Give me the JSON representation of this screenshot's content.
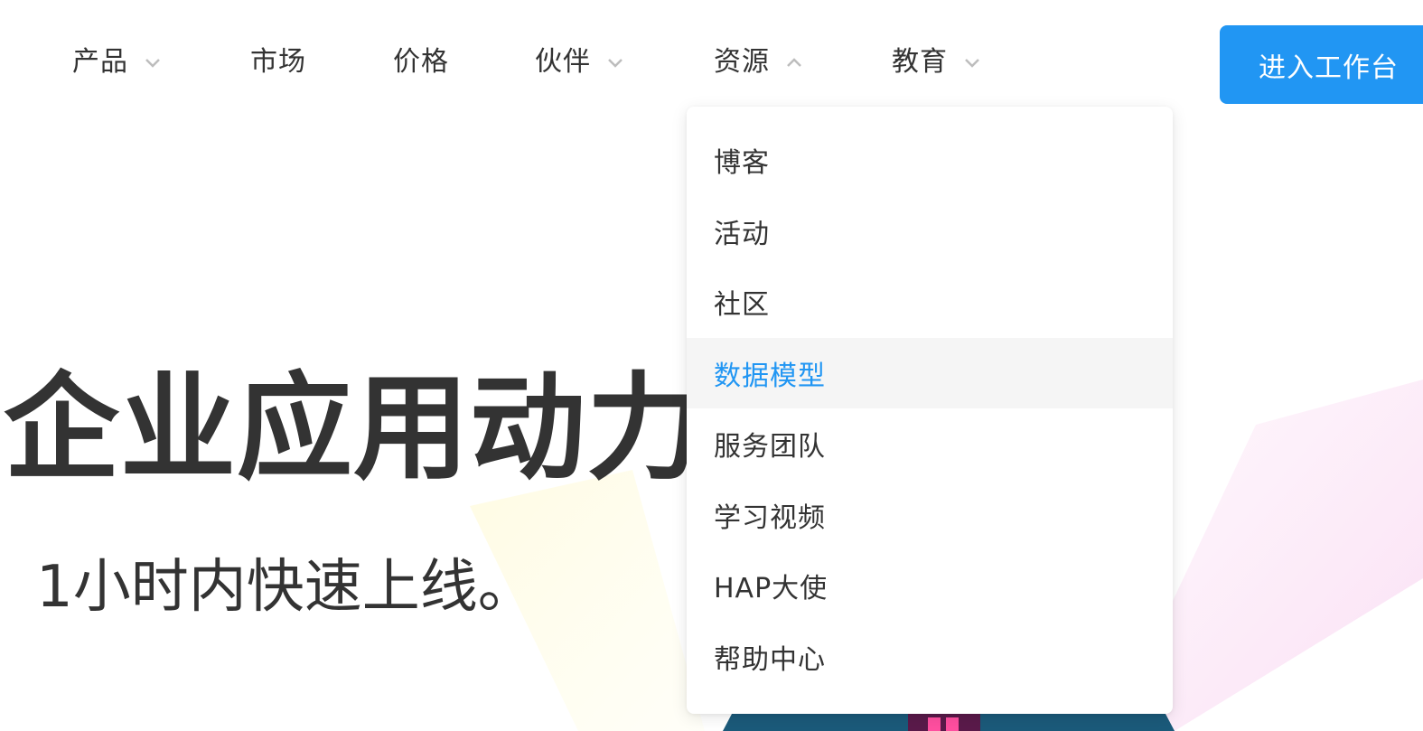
{
  "nav": {
    "items": [
      {
        "label": "产品",
        "has_dropdown": true,
        "expanded": false
      },
      {
        "label": "市场",
        "has_dropdown": false
      },
      {
        "label": "价格",
        "has_dropdown": false
      },
      {
        "label": "伙伴",
        "has_dropdown": true,
        "expanded": false
      },
      {
        "label": "资源",
        "has_dropdown": true,
        "expanded": true
      },
      {
        "label": "教育",
        "has_dropdown": true,
        "expanded": false
      }
    ],
    "cta_label": "进入工作台"
  },
  "dropdown": {
    "items": [
      {
        "label": "博客"
      },
      {
        "label": "活动"
      },
      {
        "label": "社区"
      },
      {
        "label": "数据模型",
        "active": true
      },
      {
        "label": "服务团队"
      },
      {
        "label": "学习视频"
      },
      {
        "label": "HAP大使"
      },
      {
        "label": "帮助中心"
      }
    ]
  },
  "hero": {
    "title": "企业应用动力站",
    "subtitle": "1小时内快速上线。"
  },
  "colors": {
    "accent": "#2196f3",
    "text": "#333333",
    "chevron": "#c0c0c0",
    "hover_bg": "#f5f5f5"
  }
}
